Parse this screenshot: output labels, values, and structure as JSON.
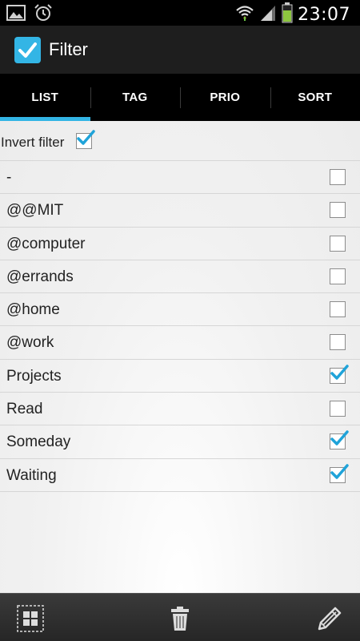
{
  "status_bar": {
    "time": "23:07",
    "icons": [
      "gallery-icon",
      "alarm-icon",
      "wifi-icon",
      "signal-icon",
      "battery-icon"
    ]
  },
  "action_bar": {
    "title": "Filter",
    "icon": "checkbox-app-icon"
  },
  "tabs": [
    {
      "label": "LIST",
      "active": true
    },
    {
      "label": "TAG",
      "active": false
    },
    {
      "label": "PRIO",
      "active": false
    },
    {
      "label": "SORT",
      "active": false
    }
  ],
  "invert_filter": {
    "label": "Invert filter",
    "checked": true
  },
  "items": [
    {
      "label": "-",
      "checked": false
    },
    {
      "label": "@@MIT",
      "checked": false
    },
    {
      "label": "@computer",
      "checked": false
    },
    {
      "label": "@errands",
      "checked": false
    },
    {
      "label": "@home",
      "checked": false
    },
    {
      "label": "@work",
      "checked": false
    },
    {
      "label": "Projects",
      "checked": true
    },
    {
      "label": "Read",
      "checked": false
    },
    {
      "label": "Someday",
      "checked": true
    },
    {
      "label": "Waiting",
      "checked": true
    }
  ],
  "bottom_bar": {
    "buttons": [
      "select-all-icon",
      "trash-icon",
      "edit-icon"
    ]
  },
  "colors": {
    "accent": "#33b5e5",
    "check": "#1fa3d9"
  }
}
